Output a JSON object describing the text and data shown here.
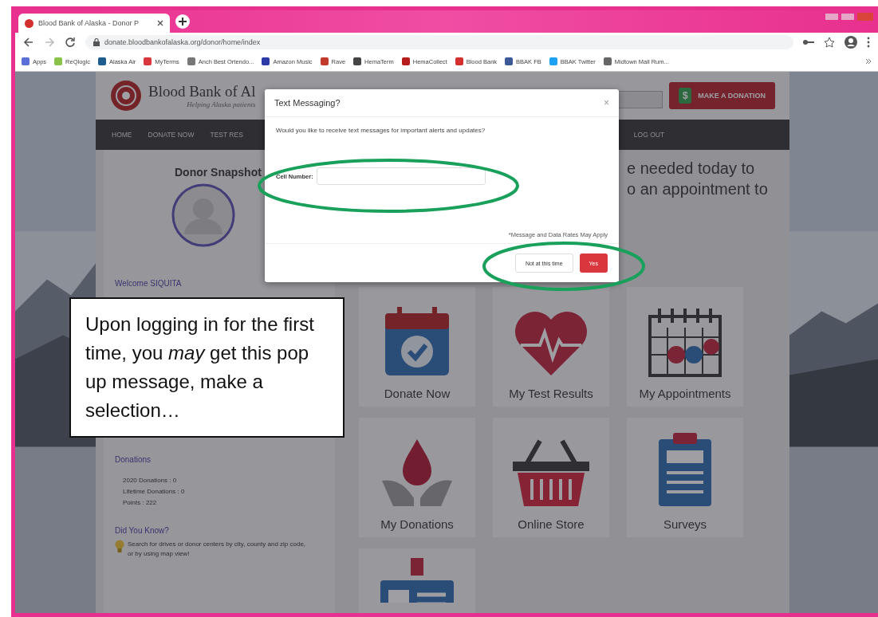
{
  "browser": {
    "tab_title": "Blood Bank of Alaska - Donor P",
    "url": "donate.bloodbankofalaska.org/donor/home/index",
    "bookmarks": [
      {
        "label": "Apps",
        "color": "#5b6fd6"
      },
      {
        "label": "ReQlogic",
        "color": "#8bc34a"
      },
      {
        "label": "Alaska Air",
        "color": "#1d5c8c"
      },
      {
        "label": "MyTerms",
        "color": "#d9363e"
      },
      {
        "label": "Anch Best Ortendo...",
        "color": "#777777"
      },
      {
        "label": "Amazon Music",
        "color": "#2c3aa8"
      },
      {
        "label": "Rave",
        "color": "#c0392b"
      },
      {
        "label": "HemaTerm",
        "color": "#444444"
      },
      {
        "label": "HemaCollect",
        "color": "#b71c1c"
      },
      {
        "label": "Blood Bank",
        "color": "#d32f2f"
      },
      {
        "label": "BBAK FB",
        "color": "#3b5998"
      },
      {
        "label": "BBAK Twitter",
        "color": "#1da1f2"
      },
      {
        "label": "Midtown Mall Rum...",
        "color": "#666666"
      }
    ]
  },
  "site": {
    "title": "Blood Bank of Al",
    "tagline": "Helping Alaska patients",
    "donate_icon": "$",
    "donate_button": "MAKE A DONATION",
    "nav": [
      "HOME",
      "DONATE NOW",
      "TEST RES",
      "LOG OUT"
    ]
  },
  "sidebar": {
    "heading": "Donor Snapshot",
    "welcome": "Welcome SIQUITA",
    "donations_heading": "Donations",
    "donation_lines": [
      "2020 Donations : 0",
      "Lifetime Donations : 0",
      "Points : 222"
    ],
    "tip_heading": "Did You Know?",
    "tip": "Search for drives or donor centers by city, county and zip code, or by using map view!"
  },
  "main": {
    "heading_lines": [
      "e needed today to",
      "o an appointment to"
    ],
    "tiles": [
      {
        "kind": "calendar",
        "label": "Donate Now"
      },
      {
        "kind": "heart",
        "label": "My Test Results"
      },
      {
        "kind": "schedule",
        "label": "My Appointments"
      },
      {
        "kind": "drop",
        "label": "My Donations"
      },
      {
        "kind": "basket",
        "label": "Online Store"
      },
      {
        "kind": "clipboard",
        "label": "Surveys"
      },
      {
        "kind": "badge"
      }
    ]
  },
  "modal": {
    "title": "Text Messaging?",
    "close": "×",
    "question": "Would you like to receive text messages for important alerts and updates?",
    "field_label": "Cell Number:",
    "note": "*Message and Data Rates May Apply",
    "buttons": [
      {
        "label": "Not at this time",
        "kind": "secondary"
      },
      {
        "label": "Yes",
        "kind": "primary"
      }
    ]
  },
  "callout": {
    "text": "Upon logging in for the first time, you *may* get this pop up message, make a selection…"
  }
}
